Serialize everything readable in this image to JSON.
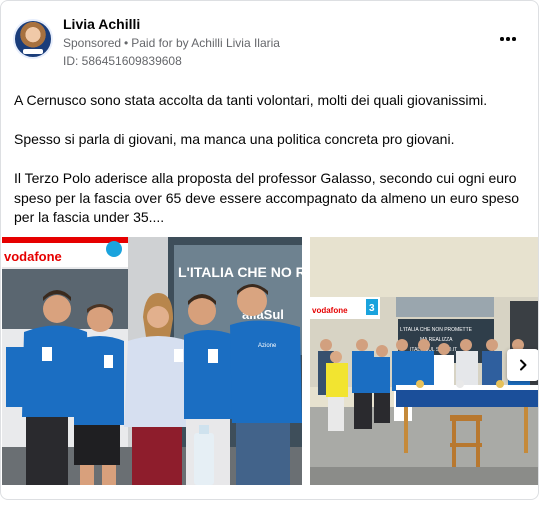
{
  "post": {
    "author": "Livia Achilli",
    "sponsored_label": "Sponsored",
    "separator": "•",
    "paid_for": "Paid for by Achilli Livia Ilaria",
    "ad_id": "ID: 586451609839608",
    "paragraphs": [
      "A Cernusco sono stata accolta da tanti volontari, molti dei quali giovanissimi.",
      "Spesso si parla di giovani, ma manca una politica concreta pro giovani.",
      "Il Terzo Polo aderisce alla proposta del professor Galasso, secondo cui ogni euro speso per la fascia over 65 deve essere accompagnato da almeno un euro speso per la fascia under 35...."
    ]
  },
  "photo1": {
    "store_sign": "vodafone",
    "poster_text": "L'ITALIA CHE NO REA",
    "poster_text_2": "aliaSul",
    "shirt_logo": "Azione"
  },
  "photo2": {
    "store_sign": "vodafone",
    "store_number": "3",
    "banner_line1": "L'ITALIA CHE NON PROMETTE",
    "banner_line2": "MA REALIZZA",
    "banner_line3": "ITALIASUL SERIO.IT"
  },
  "icons": {
    "more": "more-options-icon",
    "next": "chevron-right-icon"
  },
  "colors": {
    "shirt_blue": "#1b6ec2",
    "vodafone_red": "#e60000",
    "meta_gray": "#65676b"
  }
}
